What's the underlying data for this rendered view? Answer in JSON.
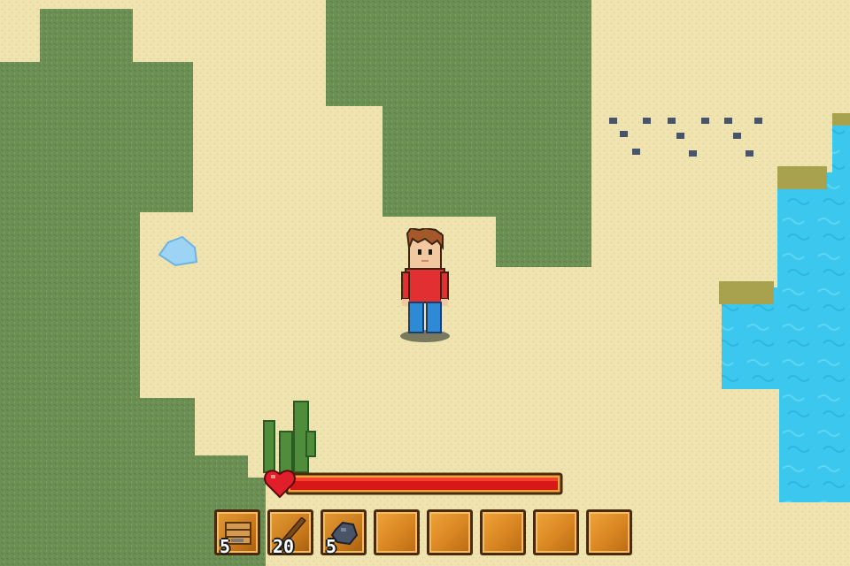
{
  "colors": {
    "sand": "#efe4b0",
    "grass": "#6b8f55",
    "water": "#3cc8ee",
    "health_fill": "#d81818",
    "slot_fill": "#d98622",
    "slot_border": "#4a2a0c"
  },
  "player": {
    "icon": "player-character-icon"
  },
  "health": {
    "icon": "heart-icon",
    "level": 1.0
  },
  "hotbar": {
    "slots": [
      {
        "item": "planks-icon",
        "count": "5"
      },
      {
        "item": "stick-icon",
        "count": "20"
      },
      {
        "item": "stone-icon",
        "count": "5"
      },
      {
        "item": "",
        "count": ""
      },
      {
        "item": "",
        "count": ""
      },
      {
        "item": "",
        "count": ""
      },
      {
        "item": "",
        "count": ""
      },
      {
        "item": "",
        "count": ""
      }
    ]
  }
}
